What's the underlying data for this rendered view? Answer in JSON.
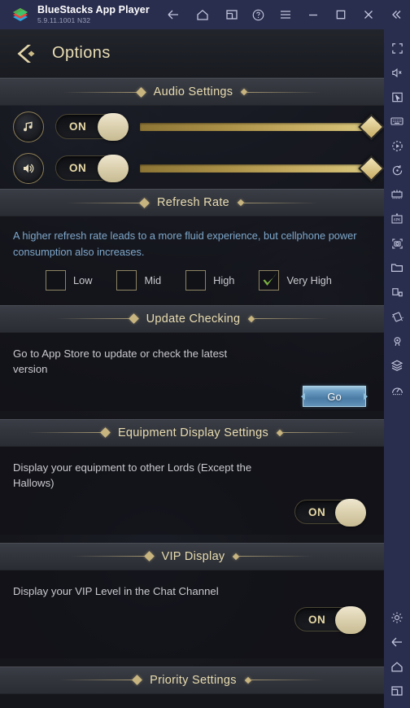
{
  "titlebar": {
    "app_name": "BlueStacks App Player",
    "version": "5.9.11.1001  N32",
    "logo_icon": "bluestacks-logo",
    "left_icons": [
      {
        "name": "back-icon",
        "label": "Back"
      },
      {
        "name": "home-icon",
        "label": "Home"
      },
      {
        "name": "recent-apps-icon",
        "label": "Recent Apps"
      }
    ],
    "right_icons": [
      {
        "name": "help-icon",
        "label": "Help"
      },
      {
        "name": "menu-icon",
        "label": "Menu"
      },
      {
        "name": "minimize-icon",
        "label": "Minimize"
      },
      {
        "name": "maximize-icon",
        "label": "Maximize"
      },
      {
        "name": "close-icon",
        "label": "Close"
      },
      {
        "name": "collapse-sidebar-icon",
        "label": "Collapse"
      }
    ]
  },
  "page": {
    "title": "Options",
    "back_icon": "back-chevron-icon"
  },
  "sections": {
    "audio": {
      "title": "Audio Settings",
      "music": {
        "icon": "music-note-icon",
        "toggle_label": "ON",
        "toggle_state": "on",
        "slider_value": 100
      },
      "sound": {
        "icon": "speaker-icon",
        "toggle_label": "ON",
        "toggle_state": "on",
        "slider_value": 100
      }
    },
    "refresh_rate": {
      "title": "Refresh Rate",
      "description": "A higher refresh rate leads to a more fluid experience, but cellphone power consumption also increases.",
      "description_color": "#7fa8cc",
      "options": [
        {
          "label": "Low",
          "checked": false
        },
        {
          "label": "Mid",
          "checked": false
        },
        {
          "label": "High",
          "checked": false
        },
        {
          "label": "Very High",
          "checked": true
        }
      ],
      "check_color": "#7cb342"
    },
    "update_checking": {
      "title": "Update Checking",
      "description": "Go to App Store to update or check the latest version",
      "button_label": "Go"
    },
    "equipment_display": {
      "title": "Equipment Display Settings",
      "description": "Display your equipment to other Lords (Except the Hallows)",
      "toggle_label": "ON",
      "toggle_state": "on"
    },
    "vip_display": {
      "title": "VIP Display",
      "description": "Display your VIP Level in the Chat Channel",
      "toggle_label": "ON",
      "toggle_state": "on"
    },
    "priority_settings": {
      "title": "Priority Settings"
    }
  },
  "sidebar": {
    "items": [
      {
        "name": "fullscreen-icon",
        "label": "Fullscreen"
      },
      {
        "name": "mute-icon",
        "label": "Mute"
      },
      {
        "name": "pointer-icon",
        "label": "Pointer"
      },
      {
        "name": "keyboard-icon",
        "label": "Game Controls"
      },
      {
        "name": "macro-recorder-icon",
        "label": "Macro Recorder"
      },
      {
        "name": "rotate-icon",
        "label": "Rotate"
      },
      {
        "name": "multi-instance-icon",
        "label": "Multi Instance"
      },
      {
        "name": "install-apk-icon",
        "label": "Install APK"
      },
      {
        "name": "screenshot-icon",
        "label": "Screenshot"
      },
      {
        "name": "media-manager-icon",
        "label": "Media Manager"
      },
      {
        "name": "device-view-icon",
        "label": "Device View"
      },
      {
        "name": "shake-icon",
        "label": "Shake"
      },
      {
        "name": "location-icon",
        "label": "Location"
      },
      {
        "name": "layers-icon",
        "label": "Layers"
      },
      {
        "name": "performance-icon",
        "label": "Performance"
      }
    ],
    "bottom_items": [
      {
        "name": "settings-gear-icon",
        "label": "Settings"
      },
      {
        "name": "back-icon",
        "label": "Back"
      },
      {
        "name": "home-icon",
        "label": "Home"
      },
      {
        "name": "recent-apps-icon",
        "label": "Recent Apps"
      }
    ]
  },
  "colors": {
    "chrome": "#2a2e4e",
    "gold": "#e9dcb0",
    "accent_blue": "#6d9fc4",
    "green": "#7cb342"
  }
}
